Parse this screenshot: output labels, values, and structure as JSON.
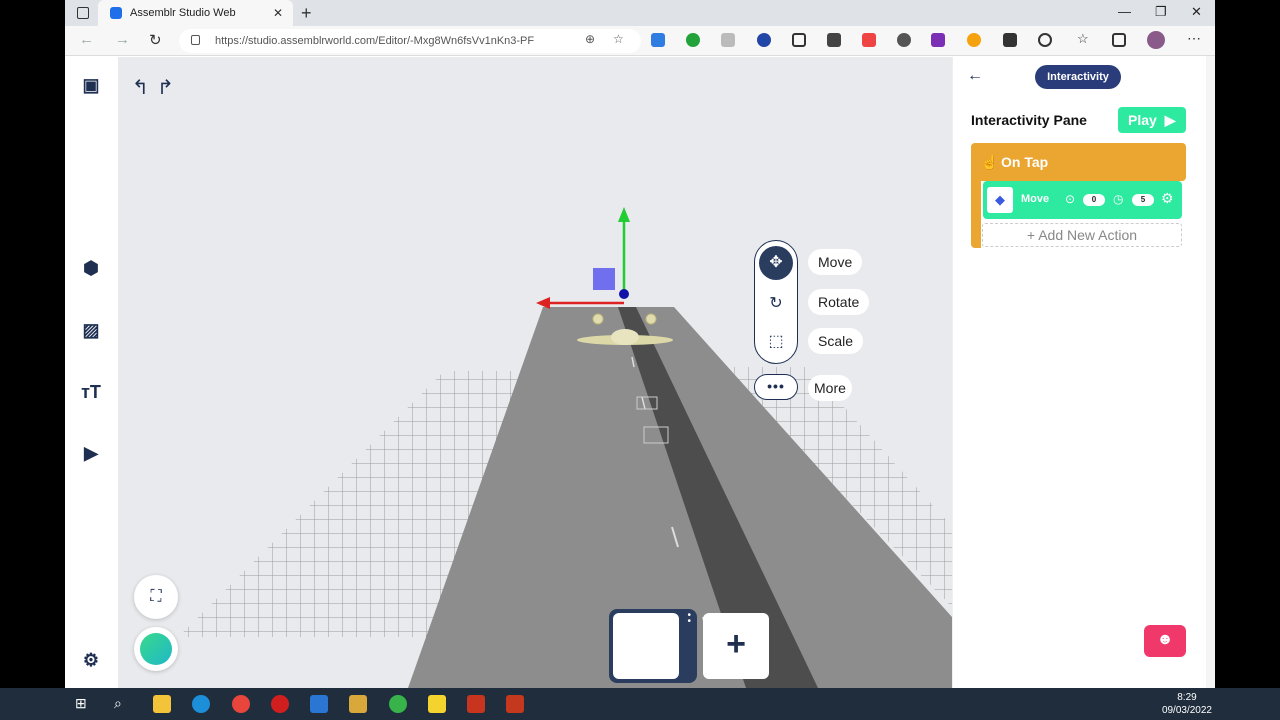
{
  "browser": {
    "tab_title": "Assemblr Studio Web",
    "url": "https://studio.assemblrworld.com/Editor/-Mxg8Wn6fsVv1nKn3-PF"
  },
  "toolbar": {
    "move_label": "Move",
    "rotate_label": "Rotate",
    "scale_label": "Scale",
    "more_label": "More"
  },
  "pane": {
    "tab_label": "Interactivity",
    "title": "Interactivity Pane",
    "play_label": "Play",
    "trigger_label": "On Tap",
    "action": {
      "label": "Move",
      "start_value": "0",
      "duration_value": "5"
    },
    "add_action_label": "Add New Action"
  },
  "taskbar": {
    "time": "8:29",
    "date": "09/03/2022"
  },
  "colors": {
    "brand_navy": "#1e2f52",
    "trigger_orange": "#eba531",
    "action_green": "#2ee9a0",
    "chat_pink": "#f0386b"
  }
}
